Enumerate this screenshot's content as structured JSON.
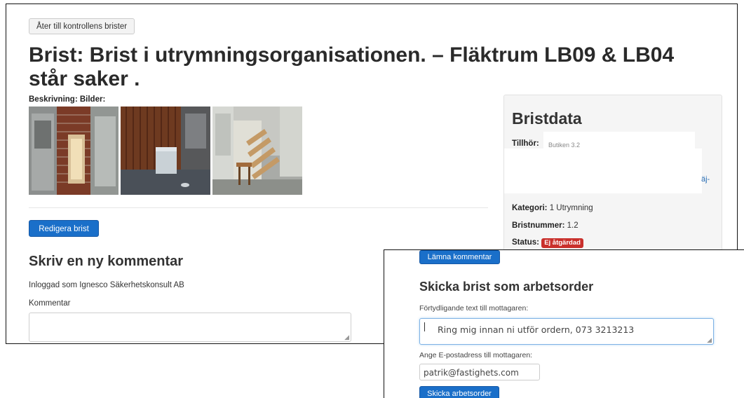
{
  "back_button": "Åter till kontrollens brister",
  "title": "Brist: Brist i utrymningsorganisationen. – Fläktrum LB09 & LB04 står saker .",
  "description_label": "Beskrivning: Bilder:",
  "photos": [
    {
      "label": "Fläktrum med ventilationsaggregat och tegelvägg"
    },
    {
      "label": "Rum med träpanel och vit låda på golvet"
    },
    {
      "label": "Rum med pallar och elskåp"
    }
  ],
  "edit_button": "Redigera brist",
  "comment_section": {
    "heading": "Skriv en ny kommentar",
    "logged_in": "Inloggad som Ignesco Säkerhetskonsult AB",
    "comment_label": "Kommentar",
    "comment_value": ""
  },
  "panel": {
    "title": "Bristdata",
    "belongs_label": "Tillhör:",
    "belongs_value": "Butiken 3.2",
    "edge_text": "äj-",
    "category_label": "Kategori:",
    "category_value": "1 Utrymning",
    "number_label": "Bristnummer:",
    "number_value": "1.2",
    "status_label": "Status:",
    "status_value": "Ej åtgärdad"
  },
  "workorder": {
    "leave_comment_button": "Lämna kommentar",
    "heading": "Skicka brist som arbetsorder",
    "message_label": "Förtydligande text till mottagaren:",
    "message_value": "Ring mig innan ni utför ordern, 073 3213213",
    "email_label": "Ange E-postadress till mottagaren:",
    "email_value": "patrik@fastighets.com",
    "send_button": "Skicka arbetsorder"
  },
  "colors": {
    "primary": "#1a6fc9",
    "danger": "#c9302c",
    "panel_bg": "#f5f5f5"
  }
}
